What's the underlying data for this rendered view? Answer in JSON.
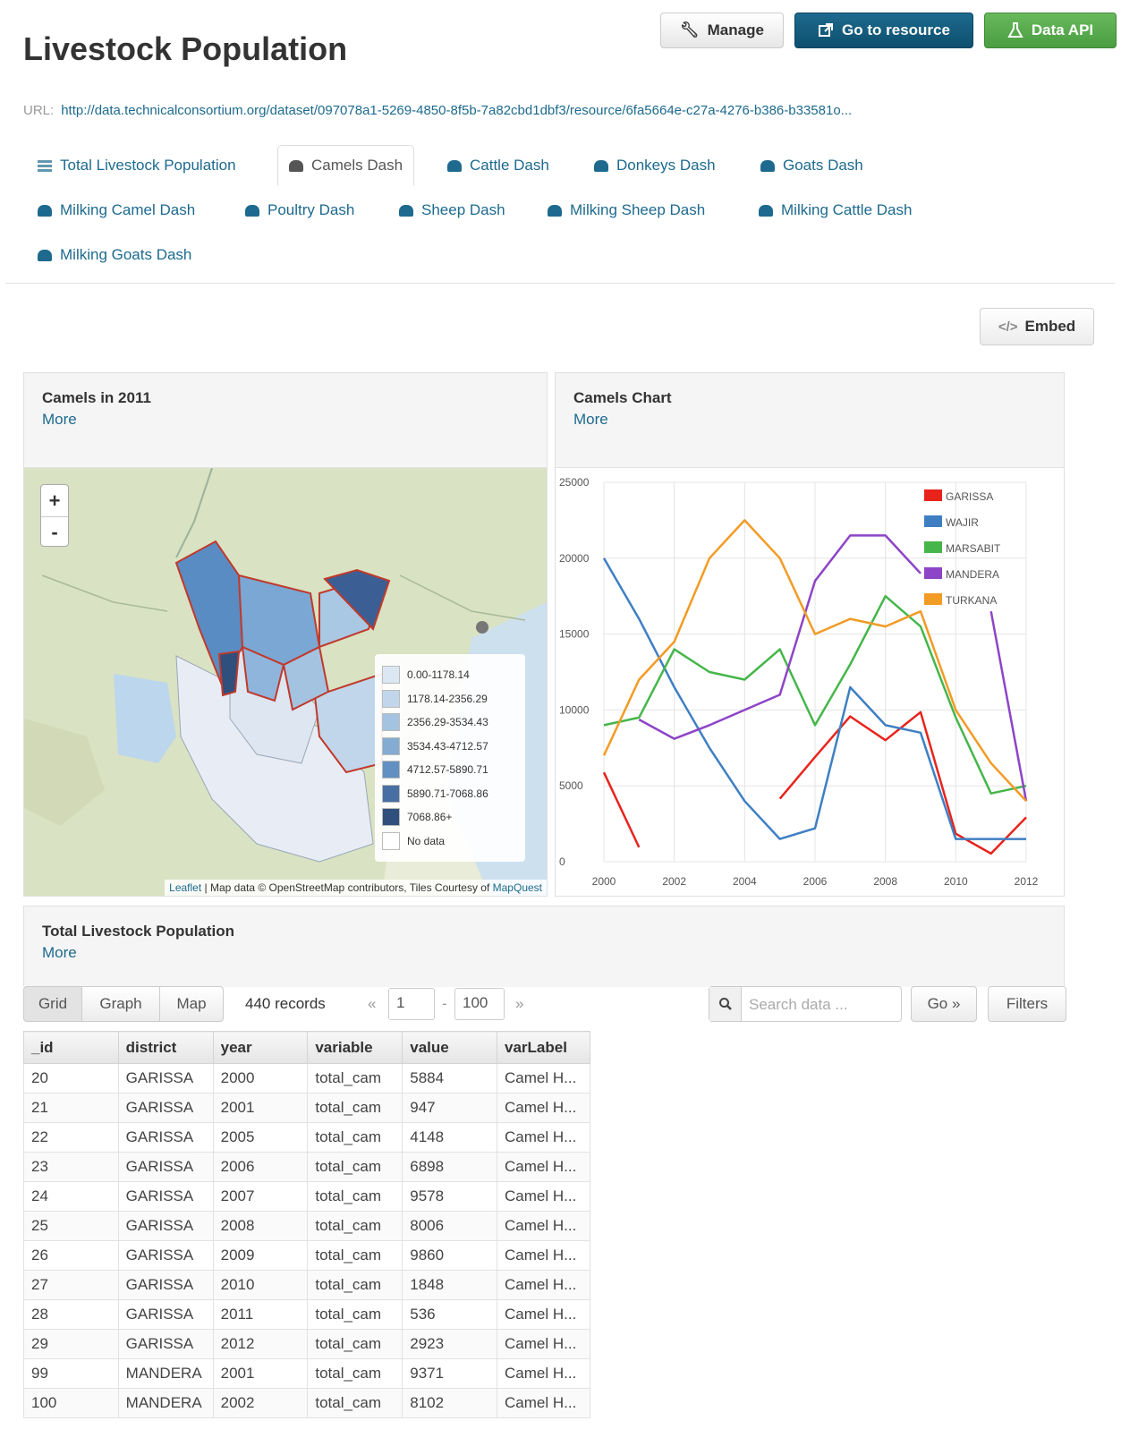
{
  "page": {
    "title": "Livestock Population"
  },
  "actions": {
    "manage": "Manage",
    "resource": "Go to resource",
    "api": "Data API",
    "embed": "Embed"
  },
  "url": {
    "label": "URL:",
    "value": "http://data.technicalconsortium.org/dataset/097078a1-5269-4850-8f5b-7a82cbd1dbf3/resource/6fa5664e-c27a-4276-b386-b33581o..."
  },
  "views": [
    {
      "label": "Total Livestock Population",
      "icon": "grid-icon"
    },
    {
      "label": "Camels Dash",
      "icon": "dashboard-icon"
    },
    {
      "label": "Cattle Dash",
      "icon": "dashboard-icon"
    },
    {
      "label": "Donkeys Dash",
      "icon": "dashboard-icon"
    },
    {
      "label": "Goats Dash",
      "icon": "dashboard-icon"
    },
    {
      "label": "Milking Camel Dash",
      "icon": "dashboard-icon"
    },
    {
      "label": "Poultry Dash",
      "icon": "dashboard-icon"
    },
    {
      "label": "Sheep Dash",
      "icon": "dashboard-icon"
    },
    {
      "label": "Milking Sheep Dash",
      "icon": "dashboard-icon"
    },
    {
      "label": "Milking Cattle Dash",
      "icon": "dashboard-icon"
    },
    {
      "label": "Milking Goats Dash",
      "icon": "dashboard-icon"
    }
  ],
  "map_panel": {
    "title": "Camels in 2011",
    "more": "More",
    "zoom_in": "+",
    "zoom_out": "-",
    "legend": [
      {
        "label": "0.00-1178.14",
        "color": "#dbe7f3"
      },
      {
        "label": "1178.14-2356.29",
        "color": "#c1d6ea"
      },
      {
        "label": "2356.29-3534.43",
        "color": "#a4c3e0"
      },
      {
        "label": "3534.43-4712.57",
        "color": "#84acd3"
      },
      {
        "label": "4712.57-5890.71",
        "color": "#6290c2"
      },
      {
        "label": "5890.71-7068.86",
        "color": "#476fa3"
      },
      {
        "label": "7068.86+",
        "color": "#2f4f7c"
      },
      {
        "label": "No data",
        "color": "#ffffff"
      }
    ],
    "attribution": {
      "leaflet": "Leaflet",
      "text": " | Map data © OpenStreetMap contributors, Tiles Courtesy of ",
      "mapquest": "MapQuest"
    }
  },
  "chart_panel": {
    "title": "Camels Chart",
    "more": "More"
  },
  "chart_data": {
    "type": "line",
    "x": [
      2000,
      2001,
      2002,
      2003,
      2004,
      2005,
      2006,
      2007,
      2008,
      2009,
      2010,
      2011,
      2012
    ],
    "ylim": [
      0,
      25000
    ],
    "xlim": [
      2000,
      2012
    ],
    "yticks": [
      0,
      5000,
      10000,
      15000,
      20000,
      25000
    ],
    "xticks": [
      2000,
      2002,
      2004,
      2006,
      2008,
      2010,
      2012
    ],
    "grid": true,
    "legend_position": "top-right",
    "series": [
      {
        "name": "GARISSA",
        "color": "#e8231c",
        "values": [
          5884,
          947,
          null,
          null,
          null,
          4148,
          6898,
          9578,
          8006,
          9860,
          1848,
          536,
          2923
        ]
      },
      {
        "name": "WAJIR",
        "color": "#3e7fc4",
        "values": [
          20000,
          16000,
          11500,
          7500,
          4000,
          1500,
          2200,
          11500,
          9000,
          8500,
          1500,
          1500,
          1500
        ]
      },
      {
        "name": "MARSABIT",
        "color": "#46b64a",
        "values": [
          9000,
          9500,
          14000,
          12500,
          12000,
          14000,
          9000,
          13000,
          17500,
          15500,
          9500,
          4500,
          5000
        ]
      },
      {
        "name": "MANDERA",
        "color": "#8e44c7",
        "values": [
          null,
          9371,
          8102,
          9000,
          10000,
          11000,
          18500,
          21500,
          21500,
          19000,
          null,
          16500,
          4000
        ]
      },
      {
        "name": "TURKANA",
        "color": "#f29b25",
        "values": [
          7000,
          12000,
          14500,
          20000,
          22500,
          20000,
          15000,
          16000,
          15500,
          16500,
          10000,
          6500,
          4000
        ]
      }
    ]
  },
  "table_panel": {
    "title": "Total Livestock Population",
    "more": "More",
    "toolbar": {
      "tabs": [
        "Grid",
        "Graph",
        "Map"
      ],
      "records": "440 records",
      "prev": "«",
      "next": "»",
      "from": "1",
      "dash": "-",
      "to": "100",
      "search_placeholder": "Search data ...",
      "go": "Go »",
      "filters": "Filters"
    },
    "columns": [
      "_id",
      "district",
      "year",
      "variable",
      "value",
      "varLabel"
    ],
    "rows": [
      [
        "20",
        "GARISSA",
        "2000",
        "total_cam",
        "5884",
        "Camel H..."
      ],
      [
        "21",
        "GARISSA",
        "2001",
        "total_cam",
        "947",
        "Camel H..."
      ],
      [
        "22",
        "GARISSA",
        "2005",
        "total_cam",
        "4148",
        "Camel H..."
      ],
      [
        "23",
        "GARISSA",
        "2006",
        "total_cam",
        "6898",
        "Camel H..."
      ],
      [
        "24",
        "GARISSA",
        "2007",
        "total_cam",
        "9578",
        "Camel H..."
      ],
      [
        "25",
        "GARISSA",
        "2008",
        "total_cam",
        "8006",
        "Camel H..."
      ],
      [
        "26",
        "GARISSA",
        "2009",
        "total_cam",
        "9860",
        "Camel H..."
      ],
      [
        "27",
        "GARISSA",
        "2010",
        "total_cam",
        "1848",
        "Camel H..."
      ],
      [
        "28",
        "GARISSA",
        "2011",
        "total_cam",
        "536",
        "Camel H..."
      ],
      [
        "29",
        "GARISSA",
        "2012",
        "total_cam",
        "2923",
        "Camel H..."
      ],
      [
        "99",
        "MANDERA",
        "2001",
        "total_cam",
        "9371",
        "Camel H..."
      ],
      [
        "100",
        "MANDERA",
        "2002",
        "total_cam",
        "8102",
        "Camel H..."
      ]
    ]
  }
}
